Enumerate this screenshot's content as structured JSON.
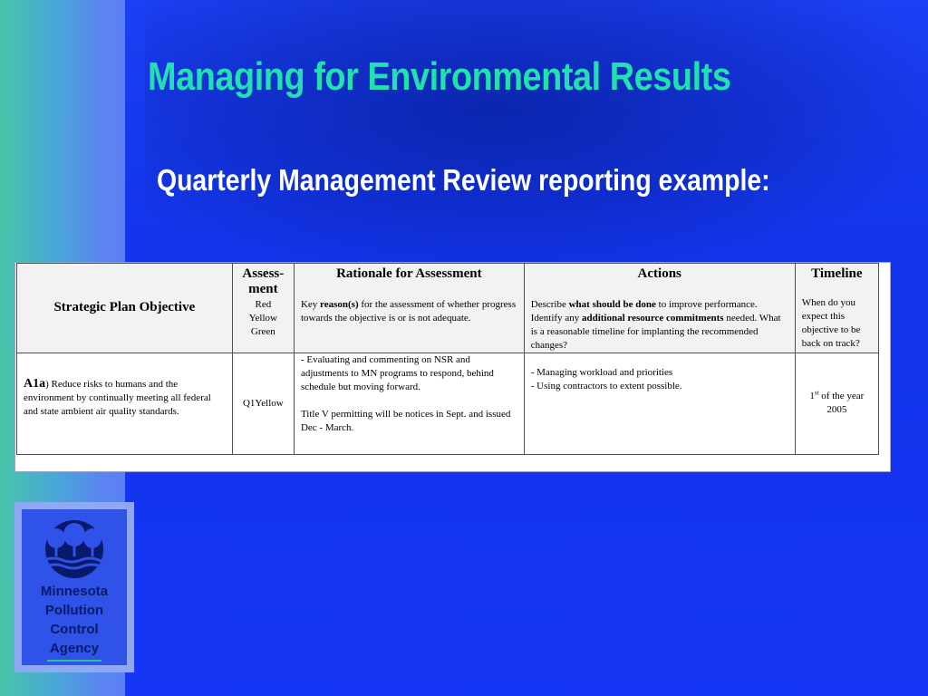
{
  "slide": {
    "title": "Managing for Environmental Results",
    "subtitle": "Quarterly Management Review reporting example:",
    "colors": {
      "background": "#1636f5",
      "title": "#22e0b0",
      "subtitle": "#ffffff",
      "stripe": "#4aa6d8"
    }
  },
  "table": {
    "headers": {
      "objective": "Strategic Plan Objective",
      "assessment_title": "Assess-ment",
      "assessment_options": [
        "Red",
        "Yellow",
        "Green"
      ],
      "rationale_title": "Rationale for Assessment",
      "rationale_desc": {
        "pre": "Key ",
        "bold": "reason(s)",
        "post": " for the assessment of whether progress towards the objective is or is not adequate."
      },
      "actions_title": "Actions",
      "actions_desc": {
        "p1": "Describe ",
        "b1": "what should be done",
        "p2": " to improve performance.  Identify any ",
        "b2": "additional resource commitments",
        "p3": " needed.  What is a reasonable timeline for implanting the recommended changes?"
      },
      "timeline_title": "Timeline",
      "timeline_desc": "When do you expect this objective to be back on track?"
    },
    "row": {
      "objective_code": "A1a",
      "objective_paren": ")",
      "objective_text": "  Reduce risks to humans and the environment by continually meeting all federal and state ambient air quality standards.",
      "assessment": "Q1Yellow",
      "rationale": [
        "- Evaluating and commenting on NSR and adjustments to MN programs to respond, behind schedule but moving forward.",
        " Title V permitting will be notices in Sept. and issued Dec - March."
      ],
      "actions": [
        "- Managing workload and priorities",
        "- Using contractors to extent possible."
      ],
      "timeline": {
        "num": "1",
        "sup": "st",
        "rest": " of the year 2005"
      }
    }
  },
  "logo": {
    "lines": [
      "Minnesota",
      "Pollution",
      "Control",
      "Agency"
    ],
    "icon": "mpca-trees-water-icon"
  }
}
